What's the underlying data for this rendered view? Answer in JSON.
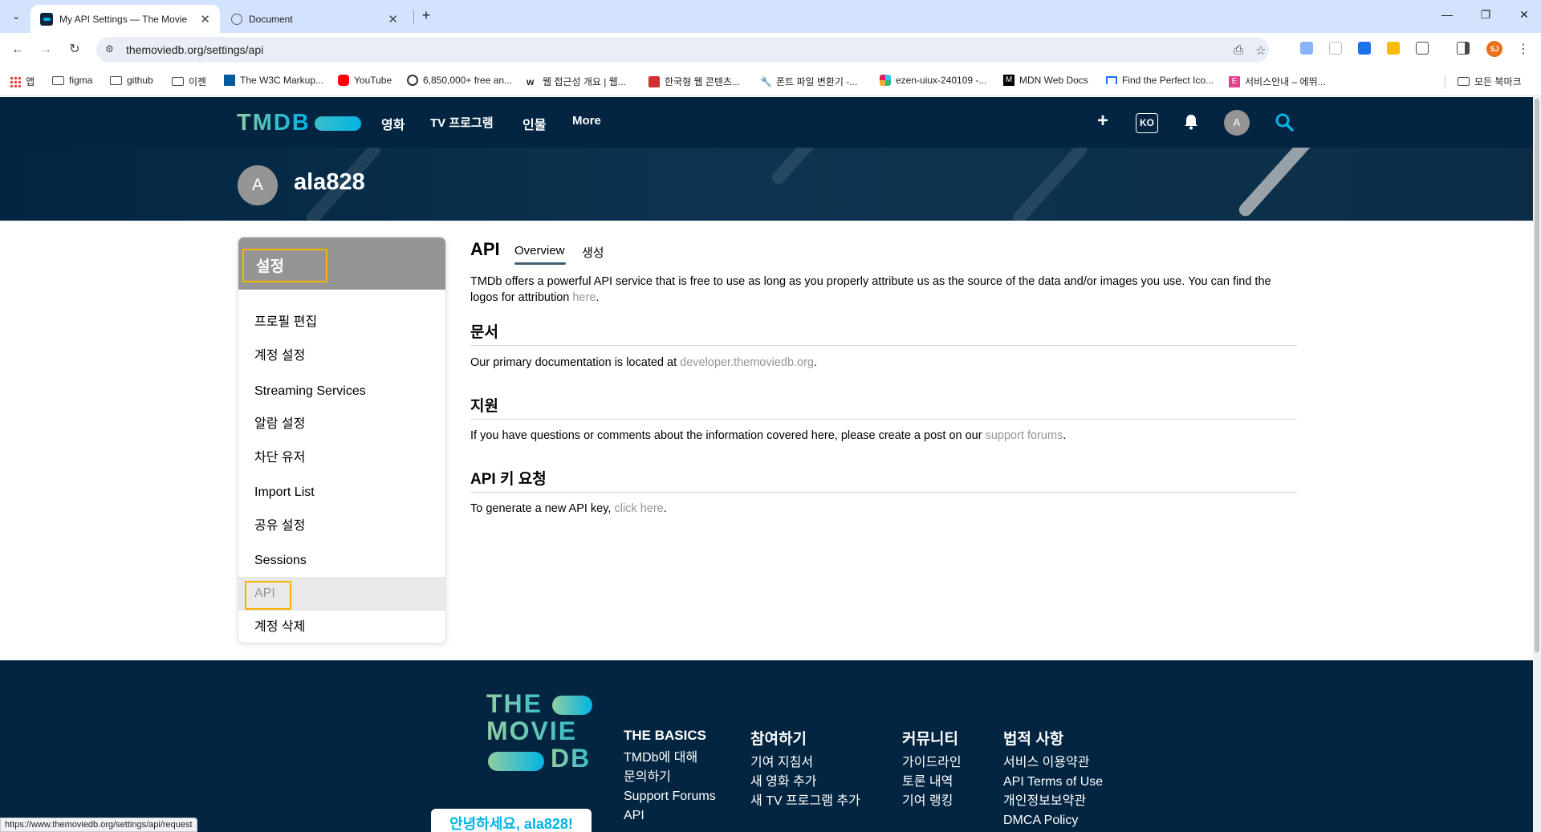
{
  "browser": {
    "tabs": [
      {
        "title": "My API Settings — The Movie",
        "active": true
      },
      {
        "title": "Document",
        "active": false
      }
    ],
    "url": "themoviedb.org/settings/api",
    "bookmarks": [
      {
        "label": "앱",
        "icon": "apps-grid-icon"
      },
      {
        "label": "figma",
        "icon": "folder-icon"
      },
      {
        "label": "github",
        "icon": "folder-icon"
      },
      {
        "label": "이젠",
        "icon": "folder-icon"
      },
      {
        "label": "The W3C Markup...",
        "icon": "w3c-icon"
      },
      {
        "label": "YouTube",
        "icon": "youtube-icon"
      },
      {
        "label": "6,850,000+ free an...",
        "icon": "flaticon-icon"
      },
      {
        "label": "웹 접근성 개요 | 웹...",
        "icon": "w-icon"
      },
      {
        "label": "한국형 웹 콘텐츠...",
        "icon": "pdf-icon"
      },
      {
        "label": "폰트 파일 변환기 -...",
        "icon": "wrench-icon"
      },
      {
        "label": "ezen-uiux-240109 -...",
        "icon": "slack-icon"
      },
      {
        "label": "MDN Web Docs",
        "icon": "mdn-icon"
      },
      {
        "label": "Find the Perfect Ico...",
        "icon": "flag-icon"
      },
      {
        "label": "서비스안내 – 에뛰...",
        "icon": "e-icon"
      },
      {
        "label": "모든 북마크",
        "icon": "folder-icon"
      }
    ],
    "profile_initials": "SJ",
    "status_url": "https://www.themoviedb.org/settings/api/request"
  },
  "header": {
    "logo": "TMDB",
    "nav": [
      "영화",
      "TV 프로그램",
      "인물",
      "More"
    ],
    "lang": "KO",
    "avatar_initial": "A"
  },
  "banner": {
    "avatar_initial": "A",
    "username": "ala828"
  },
  "sidebar": {
    "title": "설정",
    "items": [
      {
        "label": "프로필 편집"
      },
      {
        "label": "계정 설정"
      },
      {
        "label": "Streaming Services"
      },
      {
        "label": "알람 설정"
      },
      {
        "label": "차단 유저"
      },
      {
        "label": "Import List"
      },
      {
        "label": "공유 설정"
      },
      {
        "label": "Sessions"
      },
      {
        "label": "API",
        "active": true
      },
      {
        "label": "계정 삭제"
      }
    ]
  },
  "content": {
    "title": "API",
    "tabs": [
      "Overview",
      "생성"
    ],
    "intro_text": "TMDb offers a powerful API service that is free to use as long as you properly attribute us as the source of the data and/or images you use. You can find the logos for attribution ",
    "intro_link": "here",
    "intro_end": ".",
    "sections": [
      {
        "heading": "문서",
        "text": "Our primary documentation is located at ",
        "link": "developer.themoviedb.org",
        "end": "."
      },
      {
        "heading": "지원",
        "text": "If you have questions or comments about the information covered here, please create a post on our ",
        "link": "support forums",
        "end": "."
      },
      {
        "heading": "API 키 요청",
        "text": "To generate a new API key, ",
        "link": "click here",
        "end": "."
      }
    ]
  },
  "footer": {
    "logo_lines": [
      "THE",
      "MOVIE",
      "DB"
    ],
    "hello": "안녕하세요, ala828!",
    "columns": [
      {
        "title": "THE BASICS",
        "links": [
          "TMDb에 대해",
          "문의하기",
          "Support Forums",
          "API"
        ]
      },
      {
        "title": "참여하기",
        "links": [
          "기여 지침서",
          "새 영화 추가",
          "새 TV 프로그램 추가"
        ]
      },
      {
        "title": "커뮤니티",
        "links": [
          "가이드라인",
          "토론 내역",
          "기여 랭킹"
        ]
      },
      {
        "title": "법적 사항",
        "links": [
          "서비스 이용약관",
          "API Terms of Use",
          "개인정보보약관",
          "DMCA Policy"
        ]
      }
    ]
  },
  "colors": {
    "navy": "#032541",
    "tmdb_blue": "#01b4e4",
    "tmdb_green": "#90cea1",
    "highlight_box": "#f5b400"
  }
}
